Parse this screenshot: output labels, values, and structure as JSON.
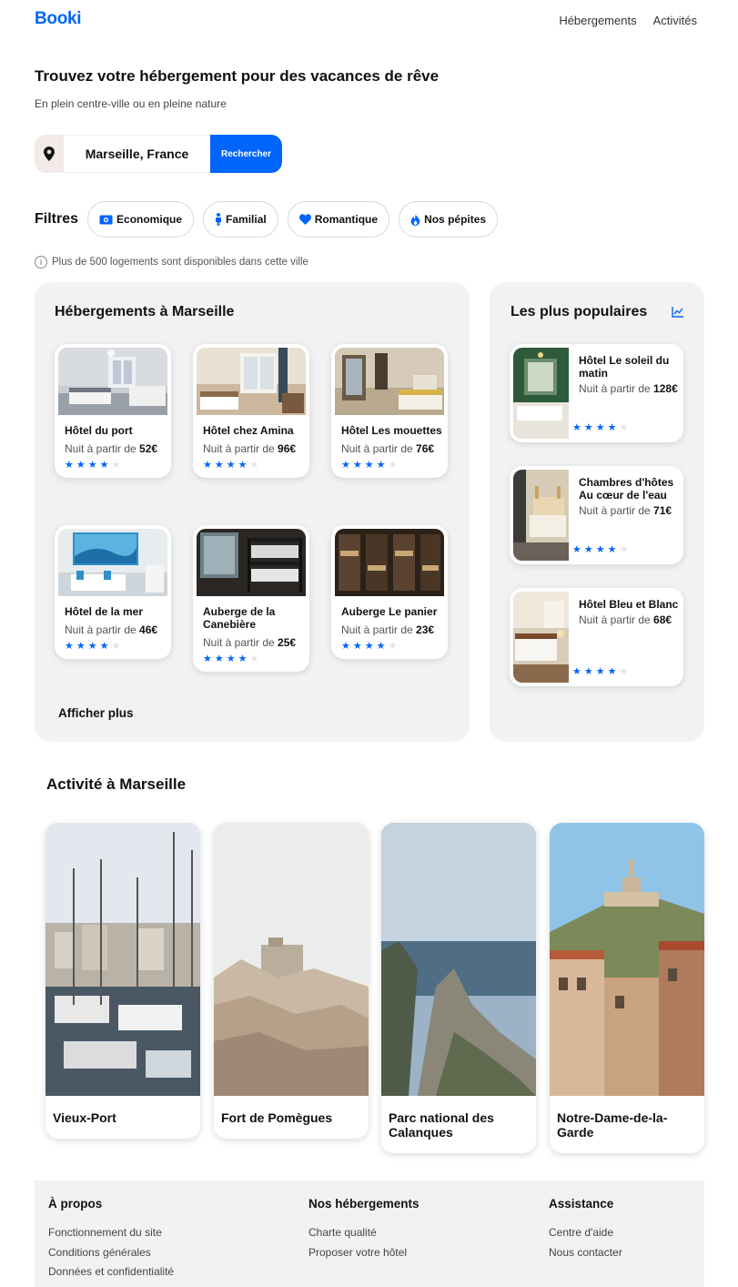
{
  "brand": {
    "logo": "Booki",
    "accent": "#0065fc"
  },
  "nav": {
    "items": [
      "Hébergements",
      "Activités"
    ]
  },
  "hero": {
    "title": "Trouvez votre hébergement pour des vacances de rêve",
    "subtitle": "En plein centre-ville ou en pleine nature"
  },
  "search": {
    "value": "Marseille, France",
    "button": "Rechercher",
    "icon": "map-pin-icon"
  },
  "filters": {
    "label": "Filtres",
    "chips": [
      {
        "label": "Economique",
        "icon": "money-icon"
      },
      {
        "label": "Familial",
        "icon": "person-icon"
      },
      {
        "label": "Romantique",
        "icon": "heart-icon"
      },
      {
        "label": "Nos pépites",
        "icon": "fire-icon"
      }
    ]
  },
  "info": {
    "text": "Plus de 500 logements sont disponibles dans cette ville"
  },
  "lodgings": {
    "title": "Hébergements à Marseille",
    "more": "Afficher plus",
    "price_prefix": "Nuit à partir de",
    "items": [
      {
        "name": "Hôtel du port",
        "price": "52€",
        "stars": 4
      },
      {
        "name": "Hôtel chez Amina",
        "price": "96€",
        "stars": 4
      },
      {
        "name": "Hôtel Les mouettes",
        "price": "76€",
        "stars": 4
      },
      {
        "name": "Hôtel de la mer",
        "price": "46€",
        "stars": 4
      },
      {
        "name": "Auberge de la Canebière",
        "price": "25€",
        "stars": 4
      },
      {
        "name": "Auberge Le panier",
        "price": "23€",
        "stars": 4
      }
    ]
  },
  "popular": {
    "title": "Les plus populaires",
    "icon": "trend-chart-icon",
    "items": [
      {
        "name": "Hôtel Le soleil du matin",
        "price": "128€",
        "stars": 4
      },
      {
        "name": "Chambres d'hôtes Au cœur de l'eau",
        "price": "71€",
        "stars": 4
      },
      {
        "name": "Hôtel Bleu et Blanc",
        "price": "68€",
        "stars": 4
      }
    ]
  },
  "activities": {
    "title": "Activité à Marseille",
    "items": [
      {
        "name": "Vieux-Port"
      },
      {
        "name": "Fort de Pomègues"
      },
      {
        "name": "Parc national des Calanques"
      },
      {
        "name": "Notre-Dame-de-la-Garde"
      }
    ]
  },
  "footer": {
    "columns": [
      {
        "title": "À propos",
        "links": [
          "Fonctionnement du site",
          "Conditions générales",
          "Données et confidentialité"
        ]
      },
      {
        "title": "Nos hébergements",
        "links": [
          "Charte qualité",
          "Proposer votre hôtel"
        ]
      },
      {
        "title": "Assistance",
        "links": [
          "Centre d'aide",
          "Nous contacter"
        ]
      }
    ]
  }
}
